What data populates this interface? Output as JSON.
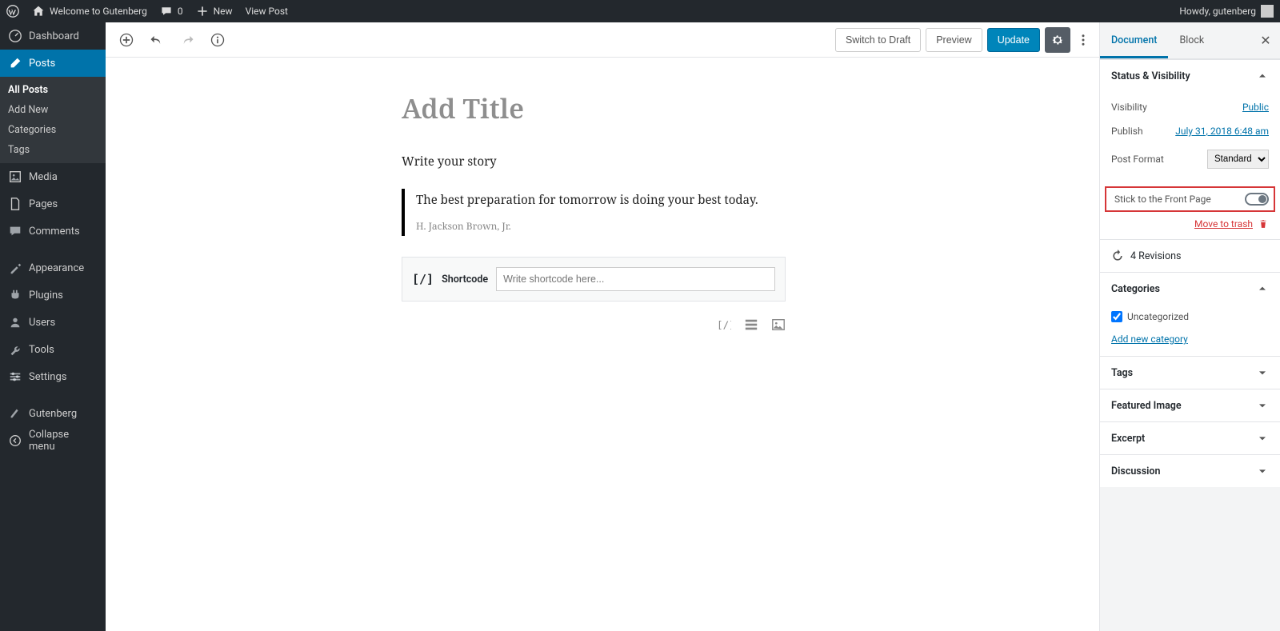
{
  "adminbar": {
    "site_name": "Welcome to Gutenberg",
    "comments": "0",
    "new_label": "New",
    "view_post": "View Post",
    "howdy": "Howdy, gutenberg"
  },
  "adminmenu": {
    "dashboard": "Dashboard",
    "posts": "Posts",
    "posts_sub": {
      "all": "All Posts",
      "add": "Add New",
      "cat": "Categories",
      "tags": "Tags"
    },
    "media": "Media",
    "pages": "Pages",
    "comments": "Comments",
    "appearance": "Appearance",
    "plugins": "Plugins",
    "users": "Users",
    "tools": "Tools",
    "settings": "Settings",
    "gutenberg": "Gutenberg",
    "collapse": "Collapse menu"
  },
  "toolbar": {
    "switch_draft": "Switch to Draft",
    "preview": "Preview",
    "update": "Update"
  },
  "content": {
    "title_placeholder": "Add Title",
    "intro": "Write your story",
    "quote": "The best preparation for tomorrow is doing your best today.",
    "quote_cite": "H. Jackson Brown, Jr.",
    "shortcode_label": "Shortcode",
    "shortcode_placeholder": "Write shortcode here..."
  },
  "sidebar": {
    "tabs": {
      "document": "Document",
      "block": "Block"
    },
    "status_visibility": "Status & Visibility",
    "visibility_label": "Visibility",
    "visibility_value": "Public",
    "publish_label": "Publish",
    "publish_value": "July 31, 2018 6:48 am",
    "post_format_label": "Post Format",
    "post_format_value": "Standard",
    "stick_label": "Stick to the Front Page",
    "trash": "Move to trash",
    "revisions": "4 Revisions",
    "categories": "Categories",
    "uncat": "Uncategorized",
    "add_category": "Add new category",
    "tags": "Tags",
    "featured": "Featured Image",
    "excerpt": "Excerpt",
    "discussion": "Discussion"
  }
}
